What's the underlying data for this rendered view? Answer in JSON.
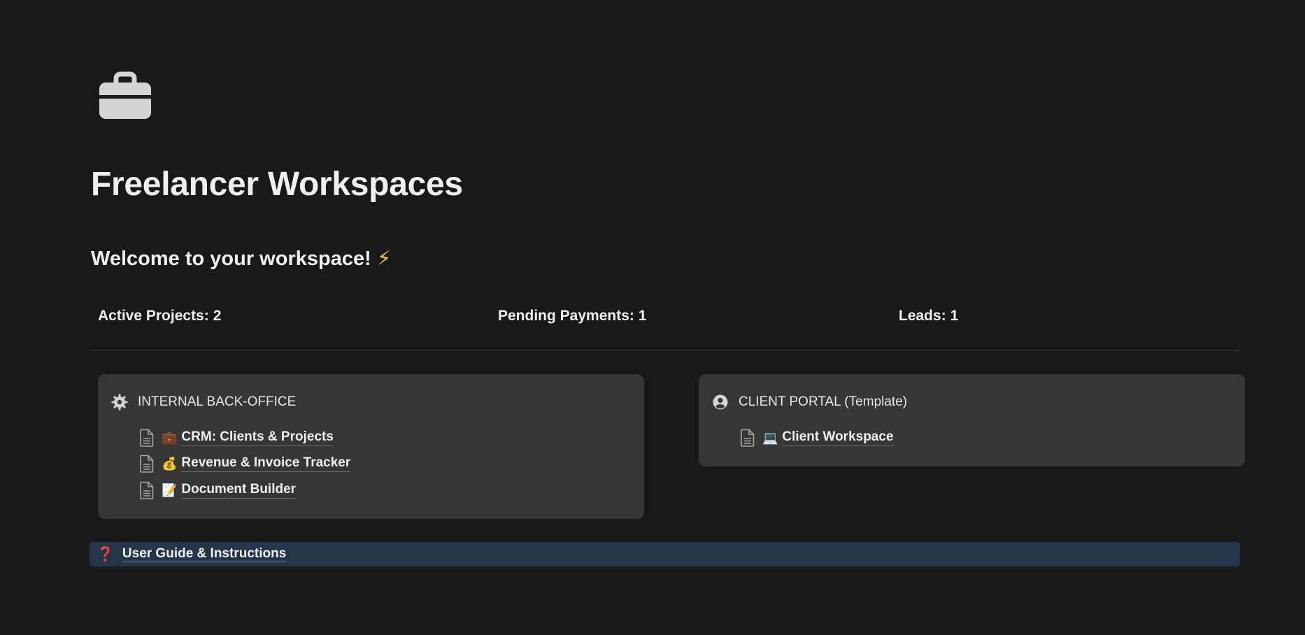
{
  "page": {
    "icon": "briefcase-icon",
    "title": "Freelancer Workspaces",
    "welcome": "Welcome to your workspace!",
    "welcome_emoji": "⚡"
  },
  "stats": [
    {
      "label": "Active Projects:",
      "value": "2"
    },
    {
      "label": "Pending Payments:",
      "value": "1"
    },
    {
      "label": "Leads:",
      "value": "1"
    }
  ],
  "back_office": {
    "icon": "gear-icon",
    "title": "INTERNAL BACK-OFFICE",
    "links": [
      {
        "emoji": "💼",
        "label": "CRM: Clients & Projects"
      },
      {
        "emoji": "💰",
        "label": "Revenue & Invoice Tracker"
      },
      {
        "emoji": "📝",
        "label": "Document Builder"
      }
    ]
  },
  "client_portal": {
    "icon": "user-circle-icon",
    "title": "CLIENT PORTAL (Template)",
    "links": [
      {
        "emoji": "💻",
        "label": "Client Workspace"
      }
    ]
  },
  "guide": {
    "icon": "question-mark-icon",
    "symbol": "❓",
    "label": "User Guide & Instructions"
  },
  "colors": {
    "background": "#191919",
    "card": "#363636",
    "guide_background": "#243449",
    "text": "#f0efed"
  }
}
